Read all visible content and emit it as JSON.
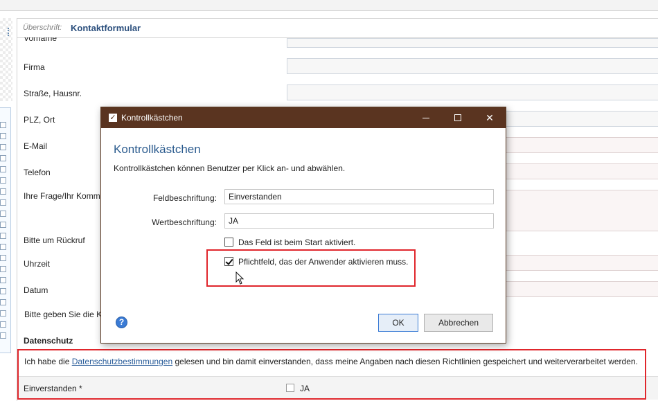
{
  "header": {
    "label": "Überschrift:",
    "value": "Kontaktformular"
  },
  "form": {
    "fields": [
      {
        "label": "Vorname"
      },
      {
        "label": "Firma"
      },
      {
        "label": "Straße, Hausnr."
      },
      {
        "label": "PLZ, Ort"
      },
      {
        "label": "E-Mail"
      },
      {
        "label": "Telefon"
      },
      {
        "label": "Ihre Frage/Ihr Komme"
      },
      {
        "label": "Bitte um Rückruf"
      },
      {
        "label": "Uhrzeit"
      },
      {
        "label": "Datum"
      },
      {
        "label": "Bitte geben Sie die K"
      }
    ],
    "section_title": "Datenschutz",
    "privacy_text_before": "Ich habe die ",
    "privacy_link": "Datenschutzbestimmungen",
    "privacy_text_after": " gelesen und bin damit einverstanden, dass meine Angaben nach diesen Richtlinien gespeichert und weiterverarbeitet werden.",
    "consent_label": "Einverstanden *",
    "consent_value": "JA"
  },
  "dialog": {
    "title": "Kontrollkästchen",
    "heading": "Kontrollkästchen",
    "description": "Kontrollkästchen können Benutzer per Klick an- und abwählen.",
    "field_label_caption": "Feldbeschriftung:",
    "field_label_value": "Einverstanden",
    "value_label_caption": "Wertbeschriftung:",
    "value_label_value": "JA",
    "option_start_active": "Das Feld ist beim Start aktiviert.",
    "option_start_active_checked": false,
    "option_required": "Pflichtfeld, das der Anwender aktivieren muss.",
    "option_required_checked": true,
    "ok_label": "OK",
    "cancel_label": "Abbrechen",
    "help_glyph": "?"
  }
}
